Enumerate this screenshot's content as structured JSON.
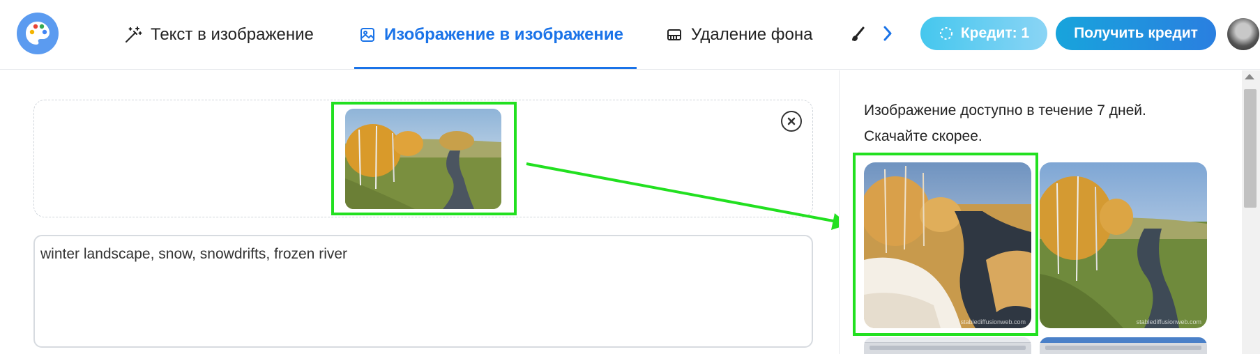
{
  "header": {
    "tabs": [
      {
        "label": "Текст в изображение",
        "icon": "magic-wand-icon"
      },
      {
        "label": "Изображение в изображение",
        "icon": "image-icon",
        "active": true
      },
      {
        "label": "Удаление фона",
        "icon": "eraser-icon"
      },
      {
        "label": "",
        "icon": "brush-icon"
      }
    ],
    "credit_label": "Кредит: 1",
    "get_credit_label": "Получить кредит"
  },
  "editor": {
    "prompt_text": "winter landscape, snow, snowdrifts, frozen river"
  },
  "results": {
    "notice_line1": "Изображение доступно в течение 7 дней.",
    "notice_line2": "Скачайте скорее.",
    "watermark": "stablediffusionweb.com"
  },
  "colors": {
    "accent": "#1a73e8",
    "highlight": "#22e020",
    "credit_button": "#45c7ee",
    "get_credit_button": "#2a7fe0"
  }
}
